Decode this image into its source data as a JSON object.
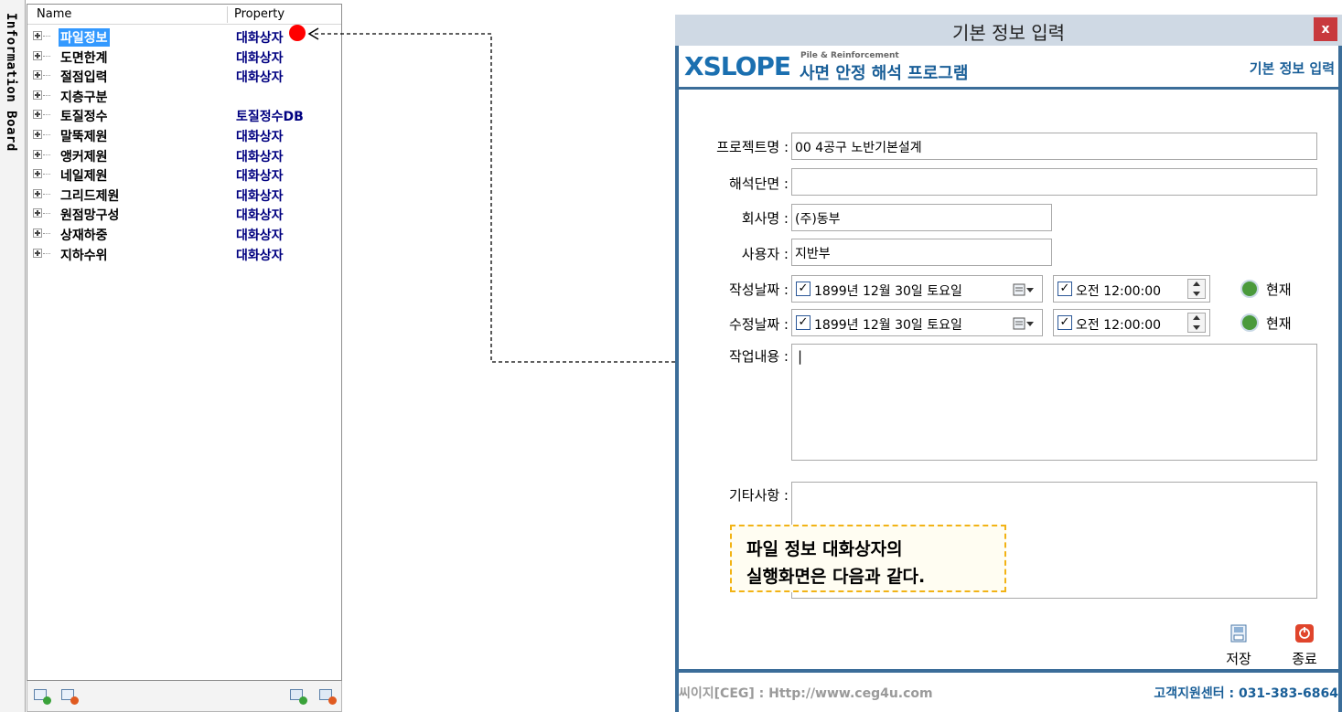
{
  "board": {
    "side_label": "Information Board",
    "header": {
      "name": "Name",
      "property": "Property"
    },
    "rows": [
      {
        "name": "파일정보",
        "property": "대화상자"
      },
      {
        "name": "도면한계",
        "property": "대화상자"
      },
      {
        "name": "절점입력",
        "property": "대화상자"
      },
      {
        "name": "지층구분",
        "property": ""
      },
      {
        "name": "토질정수",
        "property": "토질정수DB"
      },
      {
        "name": "말뚝제원",
        "property": "대화상자"
      },
      {
        "name": "앵커제원",
        "property": "대화상자"
      },
      {
        "name": "네일제원",
        "property": "대화상자"
      },
      {
        "name": "그리드제원",
        "property": "대화상자"
      },
      {
        "name": "원점망구성",
        "property": "대화상자"
      },
      {
        "name": "상재하중",
        "property": "대화상자"
      },
      {
        "name": "지하수위",
        "property": "대화상자"
      }
    ],
    "selected_index": 0
  },
  "dialog": {
    "title": "기본 정보 입력",
    "close_label": "x",
    "banner": {
      "logo": "XSLOPE",
      "small": "Pile & Reinforcement",
      "subtitle": "사면 안정 해석 프로그램",
      "right": "기본 정보 입력"
    },
    "fields": {
      "project_label": "프로젝트명 :",
      "project_value": "00 4공구 노반기본설계",
      "section_label": "해석단면 :",
      "section_value": "",
      "company_label": "회사명 :",
      "company_value": "(주)동부",
      "user_label": "사용자 :",
      "user_value": "지반부",
      "created_label": "작성날짜 :",
      "created_date": "1899년 12월 30일 토요일",
      "created_time": "오전 12:00:00",
      "modified_label": "수정날짜 :",
      "modified_date": "1899년 12월 30일 토요일",
      "modified_time": "오전 12:00:00",
      "now_label": "현재",
      "work_label": "작업내용 :",
      "work_value": "|",
      "etc_label": "기타사항 :"
    },
    "buttons": {
      "save": "저장",
      "exit": "종료"
    },
    "footer": {
      "left": "씨이지[CEG] : Http://www.ceg4u.com",
      "right": "고객지원센터 : 031-383-6864"
    }
  },
  "callout": {
    "line1": "파일 정보 대화상자의",
    "line2": "실행화면은 다음과 같다."
  },
  "colors": {
    "accent": "#3b6d99",
    "selection": "#3399ff",
    "marker": "#ff0000",
    "callout_border": "#f2b315"
  }
}
